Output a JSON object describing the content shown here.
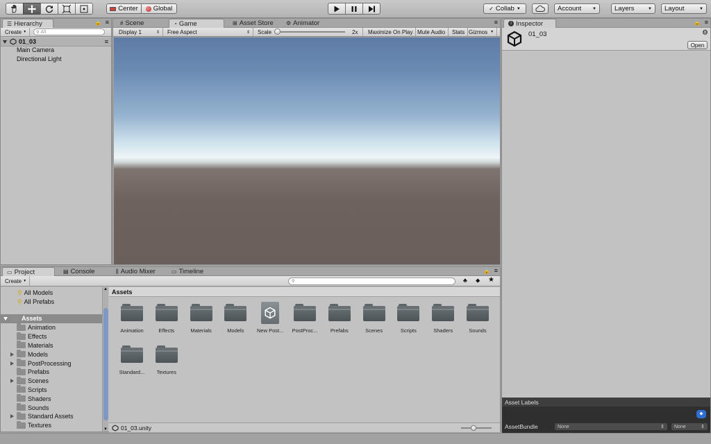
{
  "toolbar": {
    "pivot_label": "Center",
    "space_label": "Global",
    "collab_label": "Collab",
    "account_label": "Account",
    "layers_label": "Layers",
    "layout_label": "Layout"
  },
  "hierarchy": {
    "tab_label": "Hierarchy",
    "create_label": "Create",
    "search_placeholder": "All",
    "scene_name": "01_03",
    "items": [
      {
        "label": "Main Camera"
      },
      {
        "label": "Directional Light"
      }
    ]
  },
  "scene_tabs": [
    {
      "label": "Scene",
      "icon": "grid-icon"
    },
    {
      "label": "Game",
      "icon": "pacman-icon"
    },
    {
      "label": "Asset Store",
      "icon": "cart-icon"
    },
    {
      "label": "Animator",
      "icon": "animator-icon"
    }
  ],
  "game_toolbar": {
    "display": "Display 1",
    "aspect": "Free Aspect",
    "scale_label": "Scale",
    "scale_value": "2x",
    "maximize": "Maximize On Play",
    "mute": "Mute Audio",
    "stats": "Stats",
    "gizmos": "Gizmos"
  },
  "inspector": {
    "tab_label": "Inspector",
    "title": "01_03",
    "open_label": "Open",
    "labels_header": "Asset Labels",
    "bundle_label": "AssetBundle",
    "bundle_value": "None",
    "variant_value": "None"
  },
  "bottom_tabs": [
    {
      "label": "Project",
      "icon": "folder-icon"
    },
    {
      "label": "Console",
      "icon": "console-icon"
    },
    {
      "label": "Audio Mixer",
      "icon": "mixer-icon"
    },
    {
      "label": "Timeline",
      "icon": "timeline-icon"
    }
  ],
  "project": {
    "create_label": "Create",
    "favorites": [
      {
        "label": "All Models"
      },
      {
        "label": "All Prefabs"
      }
    ],
    "root_label": "Assets",
    "tree": [
      {
        "label": "Animation",
        "expandable": false
      },
      {
        "label": "Effects",
        "expandable": false
      },
      {
        "label": "Materials",
        "expandable": false
      },
      {
        "label": "Models",
        "expandable": true
      },
      {
        "label": "PostProcessing",
        "expandable": true
      },
      {
        "label": "Prefabs",
        "expandable": false
      },
      {
        "label": "Scenes",
        "expandable": true
      },
      {
        "label": "Scripts",
        "expandable": false
      },
      {
        "label": "Shaders",
        "expandable": false
      },
      {
        "label": "Sounds",
        "expandable": false
      },
      {
        "label": "Standard Assets",
        "expandable": true
      },
      {
        "label": "Textures",
        "expandable": false
      }
    ],
    "breadcrumb": "Assets",
    "assets": [
      {
        "label": "Animation",
        "kind": "folder"
      },
      {
        "label": "Effects",
        "kind": "folder"
      },
      {
        "label": "Materials",
        "kind": "folder"
      },
      {
        "label": "Models",
        "kind": "folder"
      },
      {
        "label": "New Post...",
        "kind": "unity"
      },
      {
        "label": "PostProc...",
        "kind": "folder"
      },
      {
        "label": "Prefabs",
        "kind": "folder"
      },
      {
        "label": "Scenes",
        "kind": "folder"
      },
      {
        "label": "Scripts",
        "kind": "folder"
      },
      {
        "label": "Shaders",
        "kind": "folder"
      },
      {
        "label": "Sounds",
        "kind": "folder"
      },
      {
        "label": "Standard...",
        "kind": "folder"
      },
      {
        "label": "Textures",
        "kind": "folder"
      }
    ],
    "status_file": "01_03.unity"
  },
  "colors": {
    "sky_top": "#5e7da8",
    "horizon": "#f1f6f8",
    "ground": "#6e625c",
    "selection": "#8a8a8a",
    "tag_blue": "#2f6ed3"
  }
}
